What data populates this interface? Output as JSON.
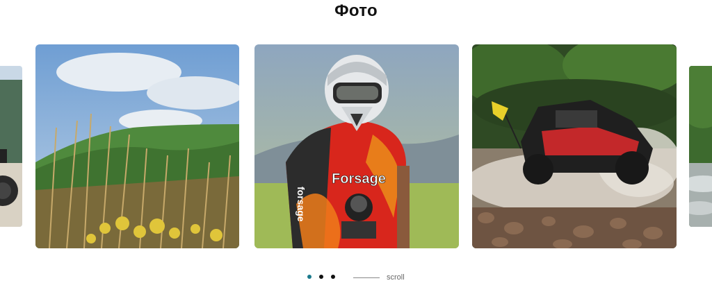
{
  "section": {
    "title": "Фото"
  },
  "gallery": {
    "photos": [
      {
        "name": "atv-partial-left",
        "alt": ""
      },
      {
        "name": "mountain-grass",
        "alt": ""
      },
      {
        "name": "rider-helmet",
        "alt": ""
      },
      {
        "name": "buggy-water-splash",
        "alt": ""
      },
      {
        "name": "river-partial-right",
        "alt": ""
      }
    ],
    "jersey_brand": "forsage",
    "jersey_text": "Forsage"
  },
  "pager": {
    "dots": 3,
    "active_index": 0,
    "active_color": "#1b7a8c",
    "scroll_label": "scroll"
  }
}
